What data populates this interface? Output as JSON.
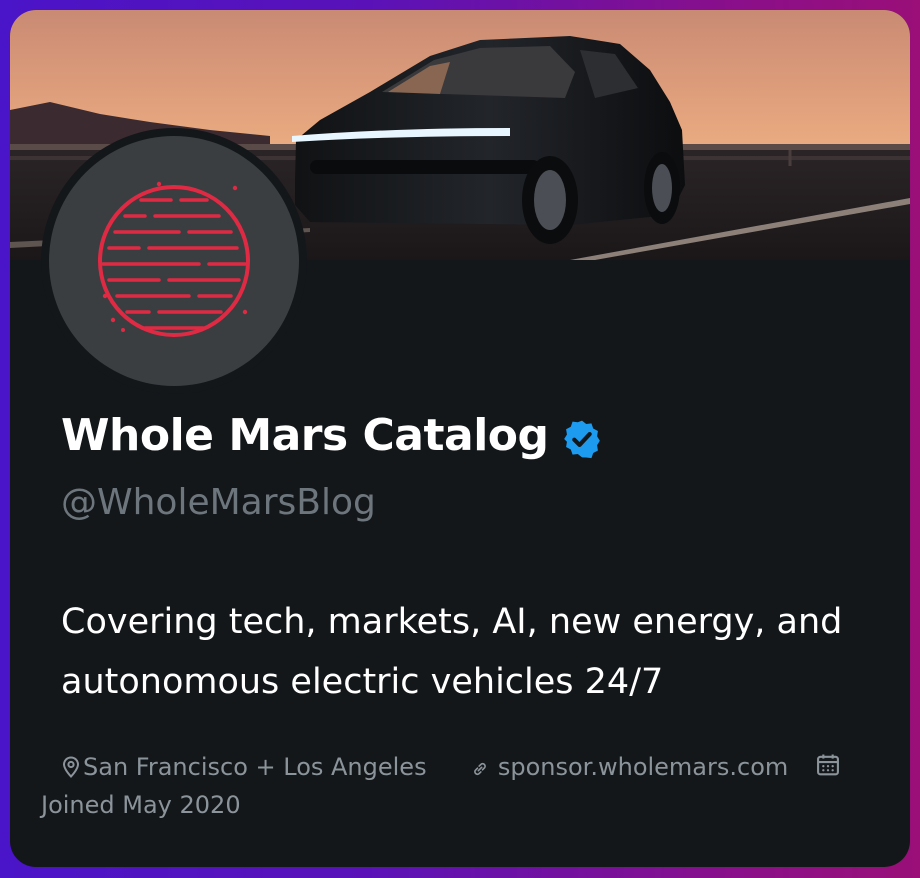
{
  "profile": {
    "name": "Whole Mars Catalog",
    "handle": "@WholeMarsBlog",
    "bio": "Covering tech, markets, AI, new energy, and autonomous electric vehicles 24/7",
    "location": "San Francisco + Los Angeles",
    "website": "sponsor.wholemars.com",
    "joined": "Joined May 2020",
    "verified": true
  },
  "icons": {
    "verified": "verified-badge-icon",
    "location": "location-pin-icon",
    "link": "link-icon",
    "calendar": "calendar-icon",
    "avatar": "striped-planet-logo"
  },
  "colors": {
    "card_background": "#13171a",
    "avatar_background": "#3a3e41",
    "logo_red": "#e02a44",
    "verified_blue": "#1d9bf0",
    "muted_text": "#8b949a",
    "handle_text": "#6e767d"
  }
}
